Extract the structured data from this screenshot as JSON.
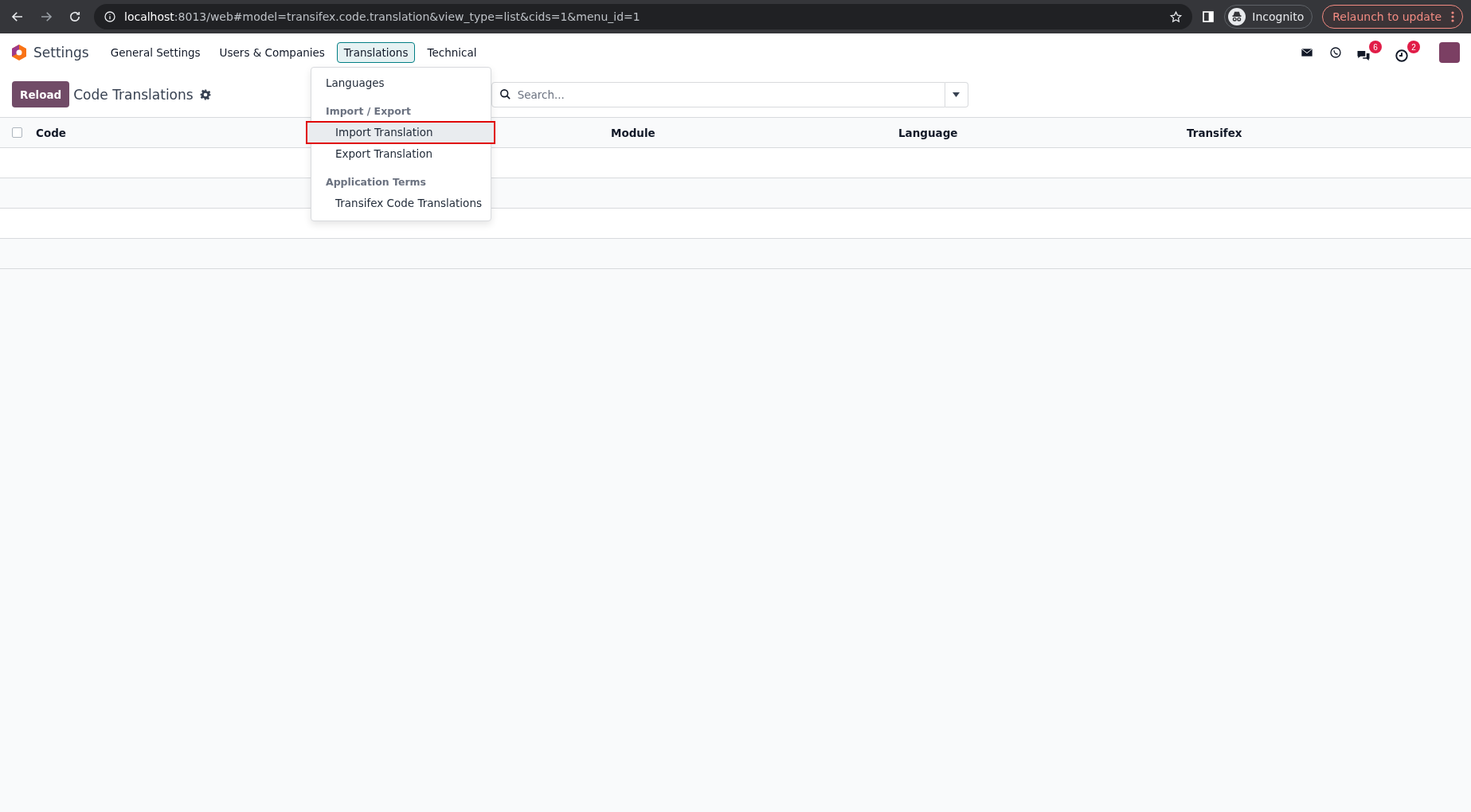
{
  "browser": {
    "url_host": "localhost",
    "url_path": ":8013/web#model=transifex.code.translation&view_type=list&cids=1&menu_id=1",
    "profile": "Incognito",
    "update_button": "Relaunch to update"
  },
  "navbar": {
    "app": "Settings",
    "menus": [
      {
        "label": "General Settings",
        "selected": false
      },
      {
        "label": "Users & Companies",
        "selected": false
      },
      {
        "label": "Translations",
        "selected": true
      },
      {
        "label": "Technical",
        "selected": false
      }
    ],
    "badges": [
      {
        "kind": "chat",
        "count": "6"
      },
      {
        "kind": "activity",
        "count": "2"
      }
    ]
  },
  "control_panel": {
    "reload_button": "Reload",
    "title": "Code Translations",
    "search_placeholder": "Search..."
  },
  "dropdown": [
    {
      "kind": "item",
      "label": "Languages",
      "highlighted": false
    },
    {
      "kind": "header",
      "label": "Import / Export"
    },
    {
      "kind": "subitem",
      "label": "Import Translation",
      "highlighted": true
    },
    {
      "kind": "subitem",
      "label": "Export Translation",
      "highlighted": false
    },
    {
      "kind": "header",
      "label": "Application Terms"
    },
    {
      "kind": "subitem",
      "label": "Transifex Code Translations",
      "highlighted": false
    }
  ],
  "table": {
    "select_all_checked": false,
    "columns": [
      "Code",
      "Module",
      "Language",
      "Transifex"
    ]
  }
}
